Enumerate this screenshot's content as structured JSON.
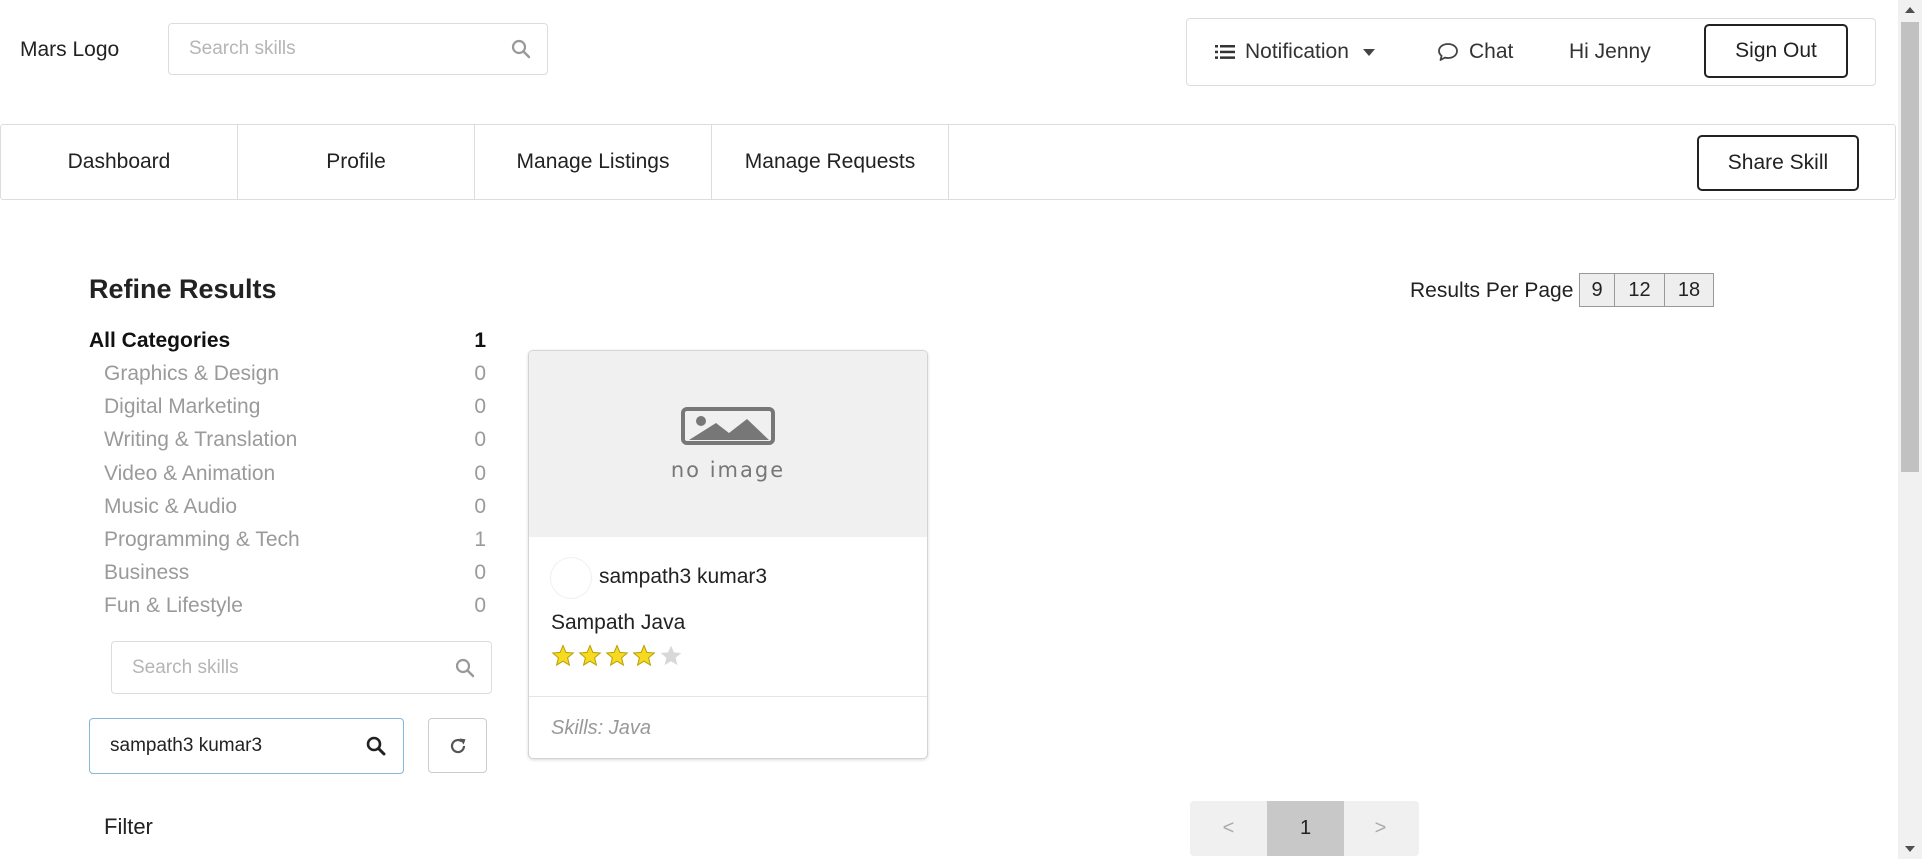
{
  "header": {
    "logo": "Mars Logo",
    "search_placeholder": "Search skills",
    "notification_label": "Notification",
    "chat_label": "Chat",
    "greeting": "Hi Jenny",
    "signout_label": "Sign Out"
  },
  "nav": {
    "items": [
      "Dashboard",
      "Profile",
      "Manage Listings",
      "Manage Requests"
    ],
    "share_label": "Share Skill"
  },
  "refine": {
    "title": "Refine Results",
    "all": {
      "name": "All Categories",
      "count": "1"
    },
    "categories": [
      {
        "name": "Graphics & Design",
        "count": "0"
      },
      {
        "name": "Digital Marketing",
        "count": "0"
      },
      {
        "name": "Writing & Translation",
        "count": "0"
      },
      {
        "name": "Video & Animation",
        "count": "0"
      },
      {
        "name": "Music & Audio",
        "count": "0"
      },
      {
        "name": "Programming & Tech",
        "count": "1"
      },
      {
        "name": "Business",
        "count": "0"
      },
      {
        "name": "Fun & Lifestyle",
        "count": "0"
      }
    ],
    "skill_search_placeholder": "Search skills",
    "user_search_value": "sampath3 kumar3",
    "filter_label": "Filter"
  },
  "results_per_page": {
    "label": "Results Per Page :",
    "options": [
      "9",
      "12",
      "18"
    ]
  },
  "card": {
    "image_text": "no image",
    "user": "sampath3 kumar3",
    "title": "Sampath Java",
    "rating": 4,
    "rating_max": 5,
    "skills": "Skills: Java"
  },
  "pagination": {
    "prev": "<",
    "current": "1",
    "next": ">"
  },
  "colors": {
    "star_filled": "#f5d922",
    "star_empty": "#d8d8d8",
    "focus_border": "#85b7d9"
  }
}
